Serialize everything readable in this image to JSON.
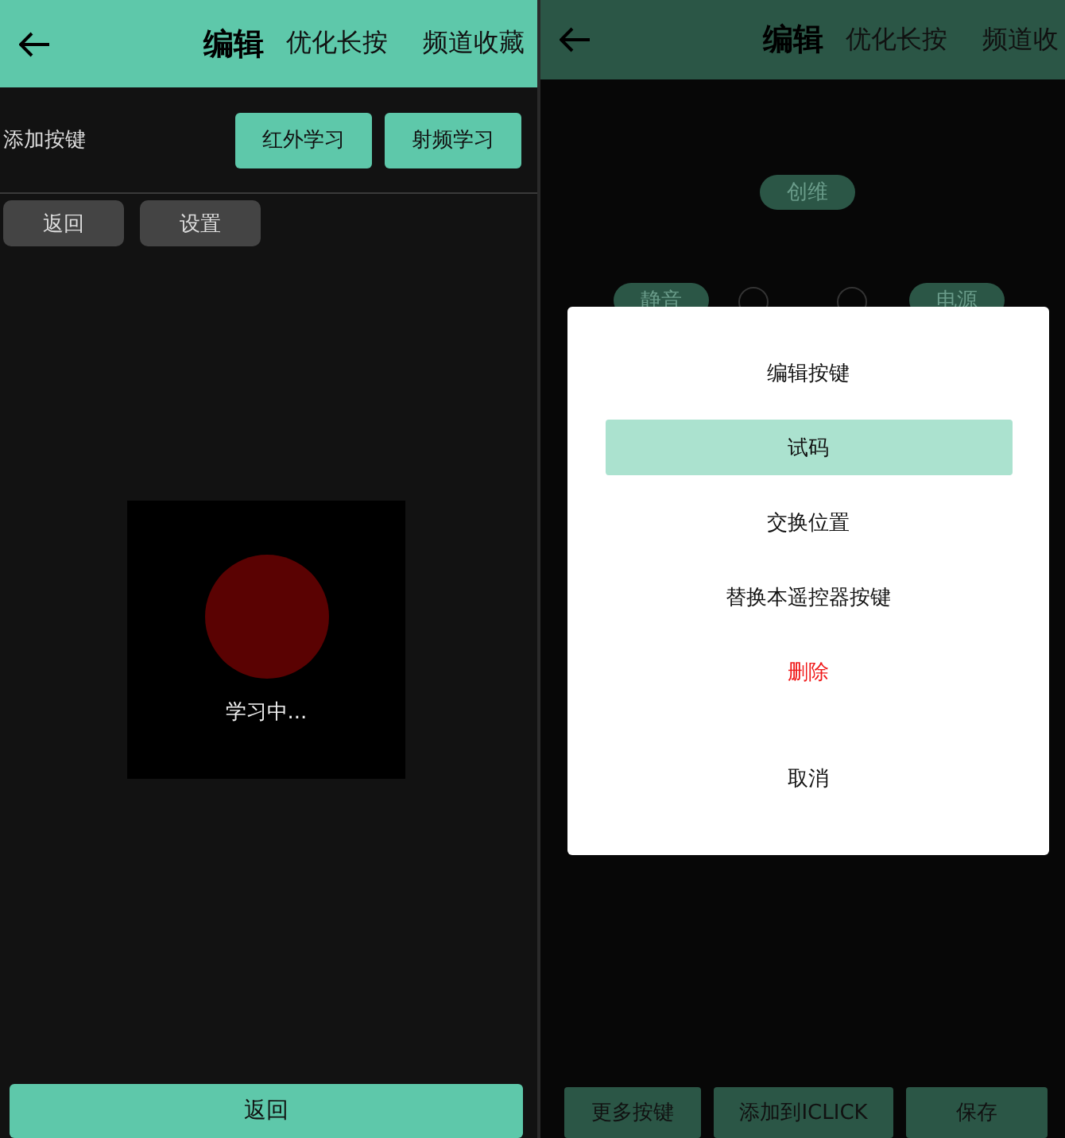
{
  "left_screen": {
    "header": {
      "title": "编辑",
      "actions": [
        "优化长按",
        "频道收藏"
      ]
    },
    "add_keys": {
      "label": "添加按键",
      "buttons": [
        "红外学习",
        "射频学习"
      ]
    },
    "tool_buttons": [
      "返回",
      "设置"
    ],
    "learning": {
      "status": "学习中..."
    },
    "bottom_button": "返回"
  },
  "right_screen": {
    "header": {
      "title": "编辑",
      "actions": [
        "优化长按",
        "频道收"
      ]
    },
    "remote_keys": {
      "top": "创维",
      "left": "静音",
      "right": "电源"
    },
    "menu": {
      "items": [
        {
          "label": "编辑按键",
          "kind": "normal",
          "selected": false
        },
        {
          "label": "试码",
          "kind": "normal",
          "selected": true
        },
        {
          "label": "交换位置",
          "kind": "normal",
          "selected": false
        },
        {
          "label": "替换本遥控器按键",
          "kind": "normal",
          "selected": false
        },
        {
          "label": "删除",
          "kind": "danger",
          "selected": false
        },
        {
          "label": "取消",
          "kind": "normal",
          "selected": false
        }
      ]
    },
    "bottom_buttons": [
      "更多按键",
      "添加到ICLICK",
      "保存"
    ]
  }
}
